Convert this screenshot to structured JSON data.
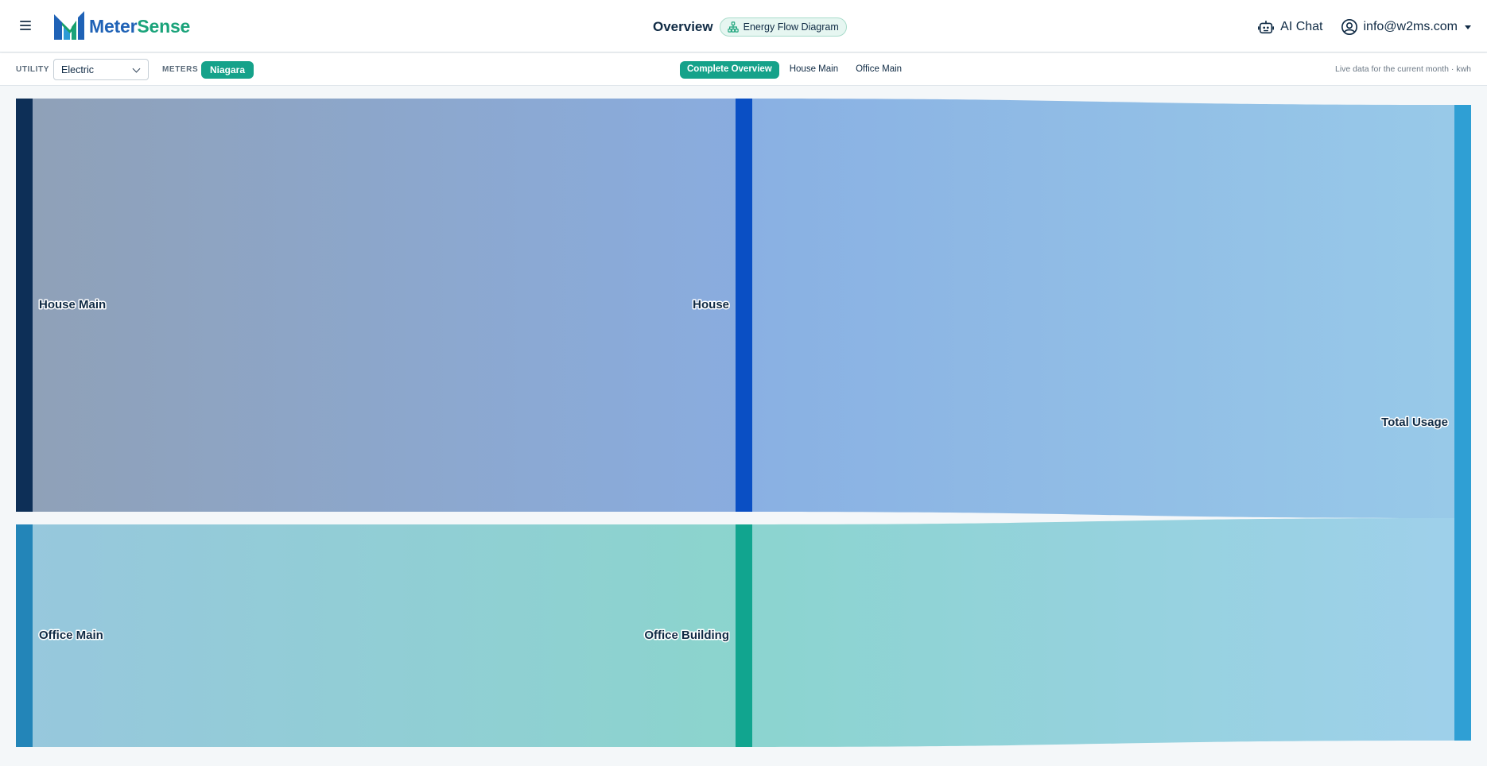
{
  "app": {
    "brand_part1": "Meter",
    "brand_part2": "Sense"
  },
  "header": {
    "title": "Overview",
    "badge": "Energy Flow Diagram",
    "ai_chat": "AI Chat",
    "user_email": "info@w2ms.com"
  },
  "toolbar": {
    "utility_label": "UTILITY",
    "utility_value": "Electric",
    "meters_label": "METERS",
    "meter_chip": "Niagara",
    "tabs": [
      {
        "label": "Complete Overview",
        "active": true
      },
      {
        "label": "House Main",
        "active": false
      },
      {
        "label": "Office Main",
        "active": false
      }
    ],
    "live_note": "Live data for the current month · kwh"
  },
  "icons": {
    "menu": "hamburger-icon",
    "flow": "sitemap-icon",
    "chat": "robot-icon",
    "user": "user-circle-icon"
  },
  "colors": {
    "brand_blue": "#1f62b6",
    "brand_green": "#1aa37a",
    "accent": "#15a28a"
  },
  "chart_data": {
    "type": "sankey",
    "nodes": [
      {
        "id": "house_main",
        "label": "House Main",
        "color": "#0d2f57"
      },
      {
        "id": "office_main",
        "label": "Office Main",
        "color": "#2385b8"
      },
      {
        "id": "house",
        "label": "House",
        "color": "#0a4fc4"
      },
      {
        "id": "office_building",
        "label": "Office Building",
        "color": "#11a58f"
      },
      {
        "id": "total",
        "label": "Total Usage",
        "color": "#2f9fd4"
      }
    ],
    "links": [
      {
        "source": "house_main",
        "target": "house",
        "value": 65
      },
      {
        "source": "office_main",
        "target": "office_building",
        "value": 35
      },
      {
        "source": "house",
        "target": "total",
        "value": 65
      },
      {
        "source": "office_building",
        "target": "total",
        "value": 35
      }
    ]
  }
}
